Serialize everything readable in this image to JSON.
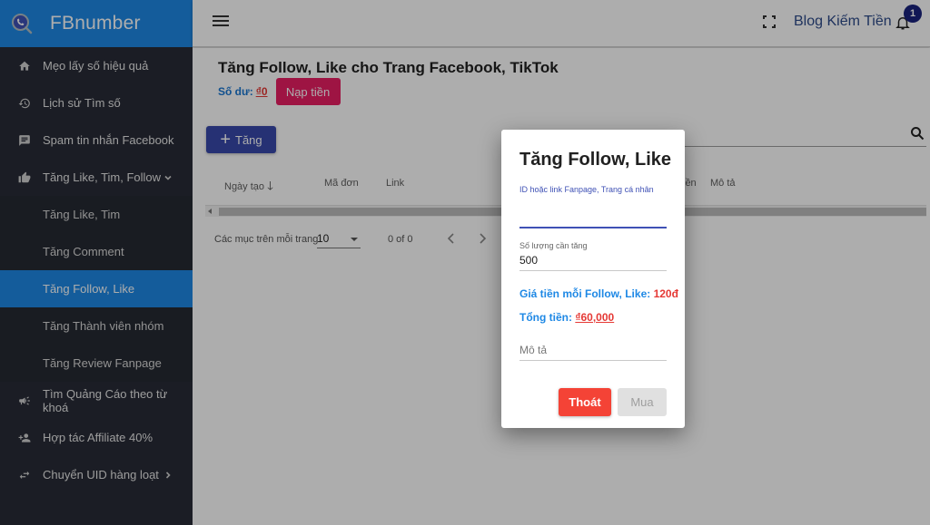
{
  "brand": {
    "name": "FBnumber"
  },
  "sidebar": {
    "items": [
      {
        "label": "Mẹo lấy số hiệu quả",
        "icon": "home-icon"
      },
      {
        "label": "Lịch sử Tìm số",
        "icon": "history-icon"
      },
      {
        "label": "Spam tin nhắn Facebook",
        "icon": "message-icon"
      },
      {
        "label": "Tăng Like, Tim, Follow",
        "icon": "thumb-up-icon",
        "expanded": true
      },
      {
        "label": "Tìm Quảng Cáo theo từ khoá",
        "icon": "megaphone-icon"
      },
      {
        "label": "Hợp tác Affiliate 40%",
        "icon": "person-add-icon"
      },
      {
        "label": "Chuyển UID hàng loạt",
        "icon": "swap-icon"
      }
    ],
    "subitems": [
      {
        "label": "Tăng Like, Tim",
        "active": false
      },
      {
        "label": "Tăng Comment",
        "active": false
      },
      {
        "label": "Tăng Follow, Like",
        "active": true
      },
      {
        "label": "Tăng Thành viên nhóm",
        "active": false
      },
      {
        "label": "Tăng Review Fanpage",
        "active": false
      }
    ]
  },
  "topbar": {
    "blog_link": "Blog Kiếm Tiền",
    "notification_count": "1"
  },
  "page": {
    "title": "Tăng Follow, Like cho Trang Facebook, TikTok",
    "balance_label": "Số dư:",
    "balance_value": "₫0",
    "topup_button": "Nạp tiền",
    "add_button": "Tăng",
    "table": {
      "columns": [
        "Ngày tạo",
        "Mã đơn",
        "Link",
        "iền",
        "Mô tả"
      ]
    },
    "pager": {
      "items_per_page_label": "Các mục trên mỗi trang",
      "items_per_page": "10",
      "range": "0 of 0"
    }
  },
  "modal": {
    "title": "Tăng Follow, Like",
    "id_field": {
      "label": "ID hoặc link Fanpage, Trang cá nhân",
      "value": ""
    },
    "quantity_field": {
      "label": "Số lượng cần tăng",
      "value": "500"
    },
    "price_label": "Giá tiền mỗi Follow, Like:",
    "price_value": "120đ",
    "total_label": "Tổng tiền:",
    "total_value": "₫60,000",
    "description_field": {
      "placeholder": "Mô tả",
      "value": ""
    },
    "exit_button": "Thoát",
    "buy_button": "Mua"
  },
  "colors": {
    "brand": "#1e88e5",
    "sidebar_bg": "#282c37",
    "primary": "#3949ab",
    "danger": "#f44336",
    "pink": "#e91e63"
  }
}
